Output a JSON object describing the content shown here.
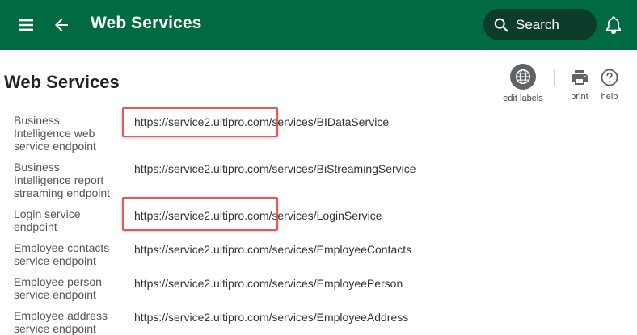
{
  "header": {
    "title": "Web Services",
    "search_placeholder": "Search"
  },
  "page": {
    "title": "Web Services"
  },
  "actions": {
    "edit_labels": "edit labels",
    "print": "print",
    "help": "help"
  },
  "rows": [
    {
      "label": "Business Intelligence web service endpoint",
      "value": "https://service2.ultipro.com/services/BIDataService"
    },
    {
      "label": "Business Intelligence report streaming endpoint",
      "value": "https://service2.ultipro.com/services/BiStreamingService"
    },
    {
      "label": "Login service endpoint",
      "value": "https://service2.ultipro.com/services/LoginService"
    },
    {
      "label": "Employee contacts service endpoint",
      "value": "https://service2.ultipro.com/services/EmployeeContacts"
    },
    {
      "label": "Employee person service endpoint",
      "value": "https://service2.ultipro.com/services/EmployeePerson"
    },
    {
      "label": "Employee address service endpoint",
      "value": "https://service2.ultipro.com/services/EmployeeAddress"
    }
  ],
  "colors": {
    "header_bg": "#006b42",
    "search_bg": "#0d3d2a",
    "highlight": "#e05a5a"
  }
}
